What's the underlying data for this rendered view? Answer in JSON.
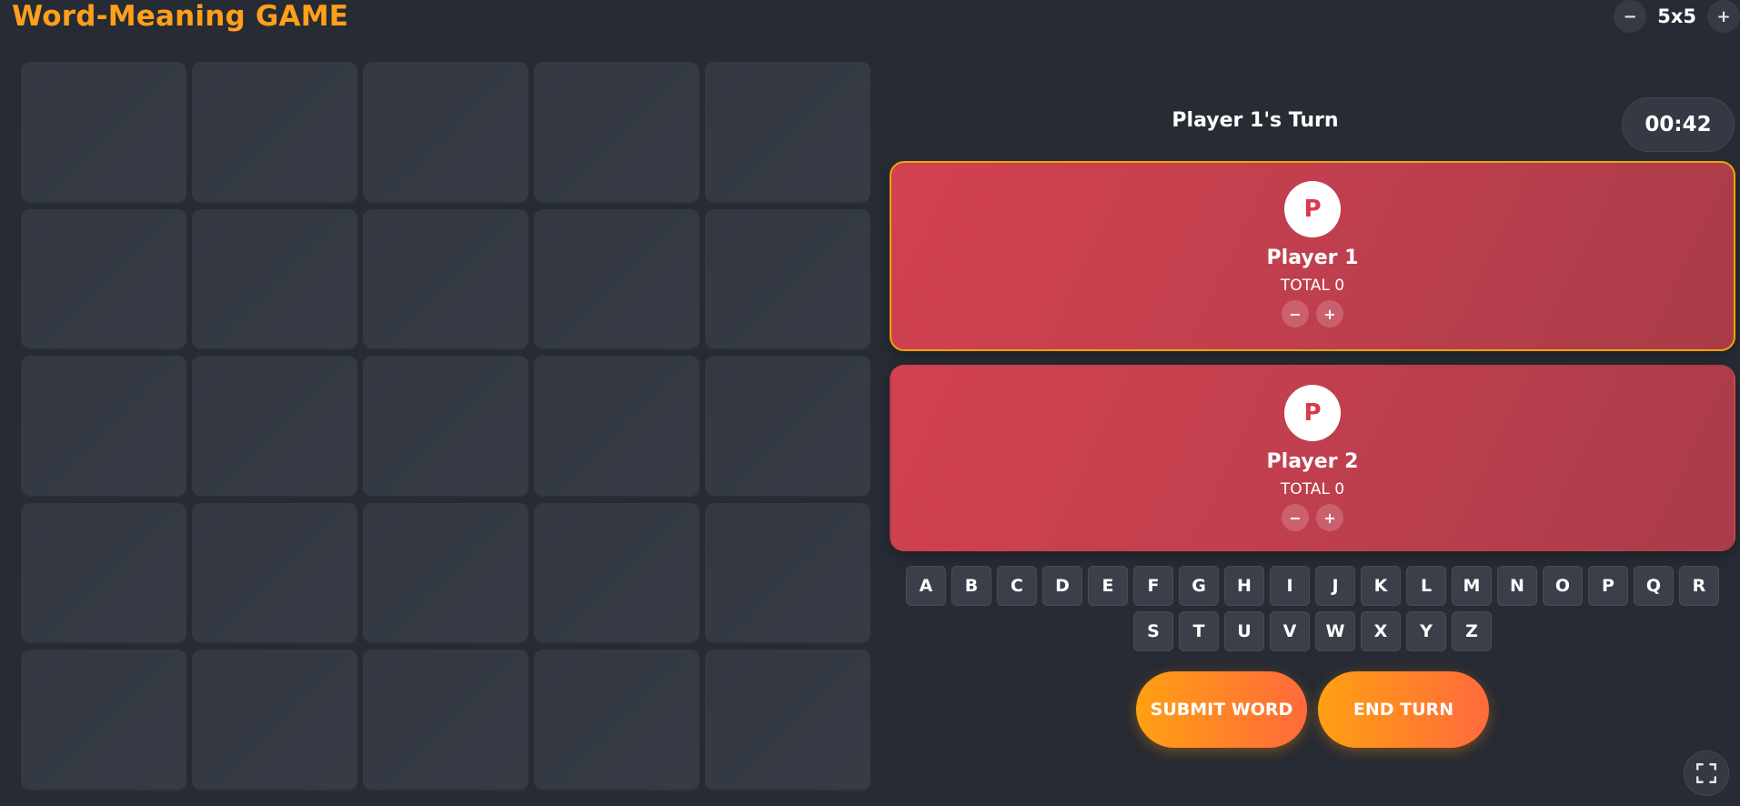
{
  "app": {
    "title": "Word-Meaning GAME"
  },
  "grid_size": {
    "decrease_label": "−",
    "value": "5x5",
    "increase_label": "+"
  },
  "board": {
    "rows": 5,
    "columns": 5
  },
  "turn": {
    "label": "Player 1's Turn",
    "timer": "00:42"
  },
  "players": [
    {
      "avatar_letter": "P",
      "name": "Player 1",
      "total": "TOTAL 0",
      "active": true,
      "minus_label": "−",
      "plus_label": "+"
    },
    {
      "avatar_letter": "P",
      "name": "Player 2",
      "total": "TOTAL 0",
      "active": false,
      "minus_label": "−",
      "plus_label": "+"
    }
  ],
  "keyboard": {
    "row1": [
      "A",
      "B",
      "C",
      "D",
      "E",
      "F",
      "G",
      "H",
      "I",
      "J",
      "K",
      "L",
      "M",
      "N",
      "O",
      "P",
      "Q",
      "R"
    ],
    "row2": [
      "S",
      "T",
      "U",
      "V",
      "W",
      "X",
      "Y",
      "Z"
    ]
  },
  "actions": {
    "submit_label": "SUBMIT WORD",
    "end_turn_label": "END TURN"
  },
  "icons": {
    "fullscreen": "fullscreen-icon"
  },
  "colors": {
    "accent": "#ff9f1a",
    "player_card": "#c8414f",
    "active_border": "#f0a400",
    "background": "#272b33"
  }
}
